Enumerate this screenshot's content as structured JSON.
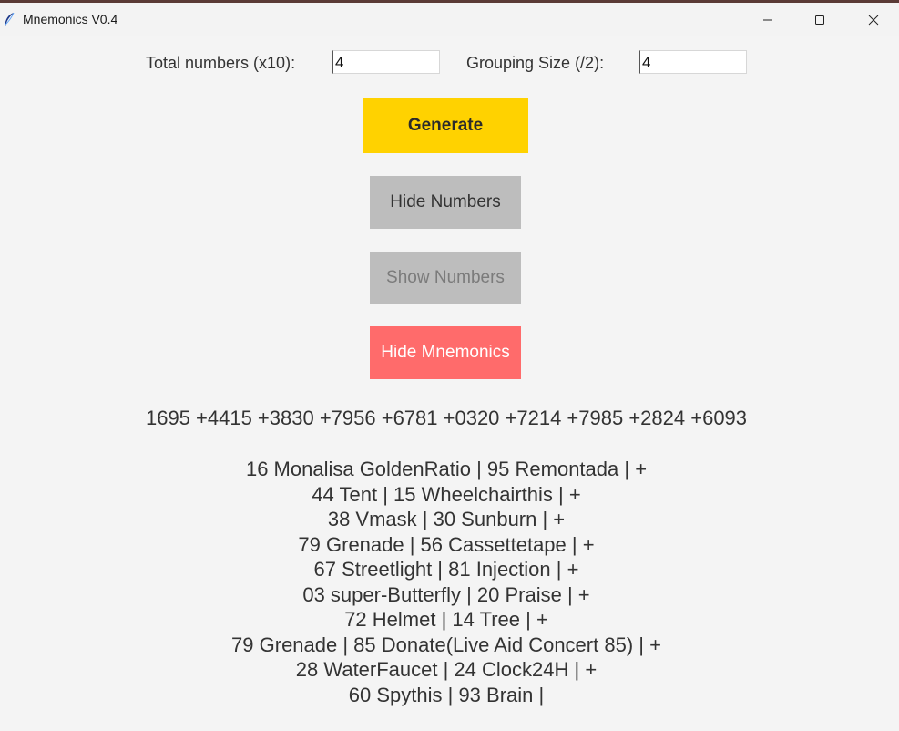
{
  "window": {
    "title": "Mnemonics V0.4",
    "icon": "feather-icon",
    "controls": [
      "minimize-icon",
      "maximize-icon",
      "close-icon"
    ]
  },
  "form": {
    "total_label": "Total numbers (x10):",
    "total_value": "4",
    "grouping_label": "Grouping Size (/2):",
    "grouping_value": "4"
  },
  "buttons": {
    "generate": "Generate",
    "hide_numbers": "Hide Numbers",
    "show_numbers": "Show Numbers",
    "hide_mnemonics": "Hide Mnemonics"
  },
  "colors": {
    "generate_bg": "#ffd200",
    "gray_button_bg": "#bdbdbd",
    "hide_mnemonics_bg": "#ff6b6b",
    "window_bg": "#f4f4f4"
  },
  "output": {
    "numbers": "1695 +4415 +3830 +7956 +6781 +0320 +7214 +7985 +2824 +6093",
    "mnemonics": [
      "16 Monalisa GoldenRatio | 95 Remontada | +",
      "44 Tent | 15 Wheelchairthis | +",
      "38 Vmask | 30 Sunburn | +",
      "79 Grenade | 56 Cassettetape | +",
      "67 Streetlight | 81 Injection | +",
      "03 super-Butterfly | 20 Praise | +",
      "72 Helmet | 14 Tree | +",
      "79 Grenade | 85 Donate(Live Aid Concert 85) | +",
      "28 WaterFaucet | 24 Clock24H | +",
      "60 Spythis | 93 Brain |"
    ]
  }
}
